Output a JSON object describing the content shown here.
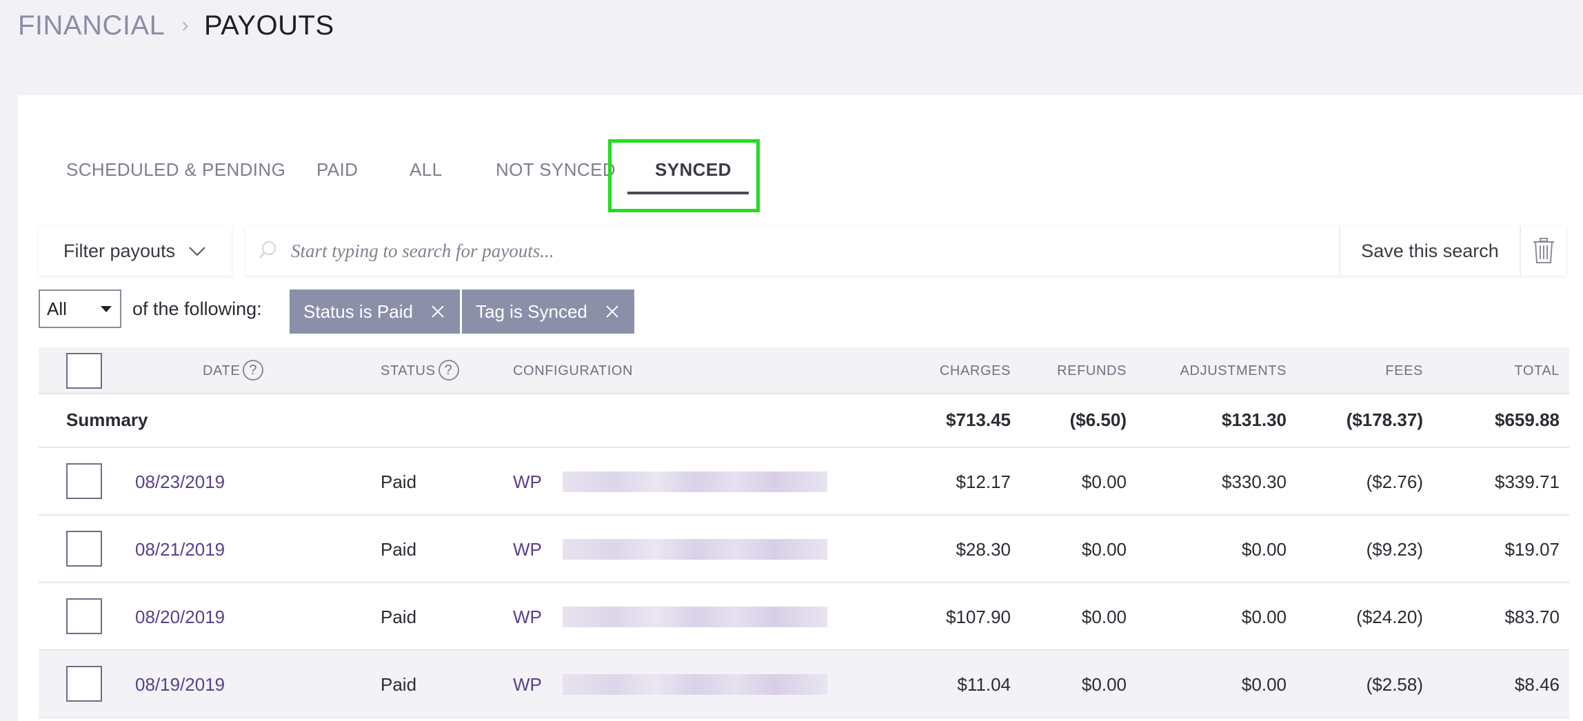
{
  "breadcrumb": {
    "parent": "FINANCIAL",
    "separator": "›",
    "current": "PAYOUTS"
  },
  "tabs": [
    {
      "label": "SCHEDULED & PENDING",
      "active": false
    },
    {
      "label": "PAID",
      "active": false
    },
    {
      "label": "ALL",
      "active": false
    },
    {
      "label": "NOT SYNCED",
      "active": false
    },
    {
      "label": "SYNCED",
      "active": true
    }
  ],
  "filter": {
    "button_label": "Filter payouts",
    "search_placeholder": "Start typing to search for payouts...",
    "save_label": "Save this search"
  },
  "conditions": {
    "match_value": "All",
    "match_label": "of the following:",
    "chips": [
      "Status is Paid",
      "Tag is Synced"
    ]
  },
  "table": {
    "headers": {
      "date": "DATE",
      "status": "STATUS",
      "configuration": "CONFIGURATION",
      "charges": "CHARGES",
      "refunds": "REFUNDS",
      "adjustments": "ADJUSTMENTS",
      "fees": "FEES",
      "total": "TOTAL"
    },
    "help_glyph": "?",
    "summary": {
      "label": "Summary",
      "charges": "$713.45",
      "refunds": "($6.50)",
      "adjustments": "$131.30",
      "fees": "($178.37)",
      "total": "$659.88"
    },
    "rows": [
      {
        "date": "08/23/2019",
        "status": "Paid",
        "config": "WP",
        "charges": "$12.17",
        "refunds": "$0.00",
        "adjustments": "$330.30",
        "fees": "($2.76)",
        "total": "$339.71"
      },
      {
        "date": "08/21/2019",
        "status": "Paid",
        "config": "WP",
        "charges": "$28.30",
        "refunds": "$0.00",
        "adjustments": "$0.00",
        "fees": "($9.23)",
        "total": "$19.07"
      },
      {
        "date": "08/20/2019",
        "status": "Paid",
        "config": "WP",
        "charges": "$107.90",
        "refunds": "$0.00",
        "adjustments": "$0.00",
        "fees": "($24.20)",
        "total": "$83.70"
      },
      {
        "date": "08/19/2019",
        "status": "Paid",
        "config": "WP",
        "charges": "$11.04",
        "refunds": "$0.00",
        "adjustments": "$0.00",
        "fees": "($2.58)",
        "total": "$8.46"
      }
    ]
  },
  "colors": {
    "accent_highlight": "#22dd22",
    "link": "#5a3f8e",
    "chip_bg": "#8b8fa8"
  }
}
